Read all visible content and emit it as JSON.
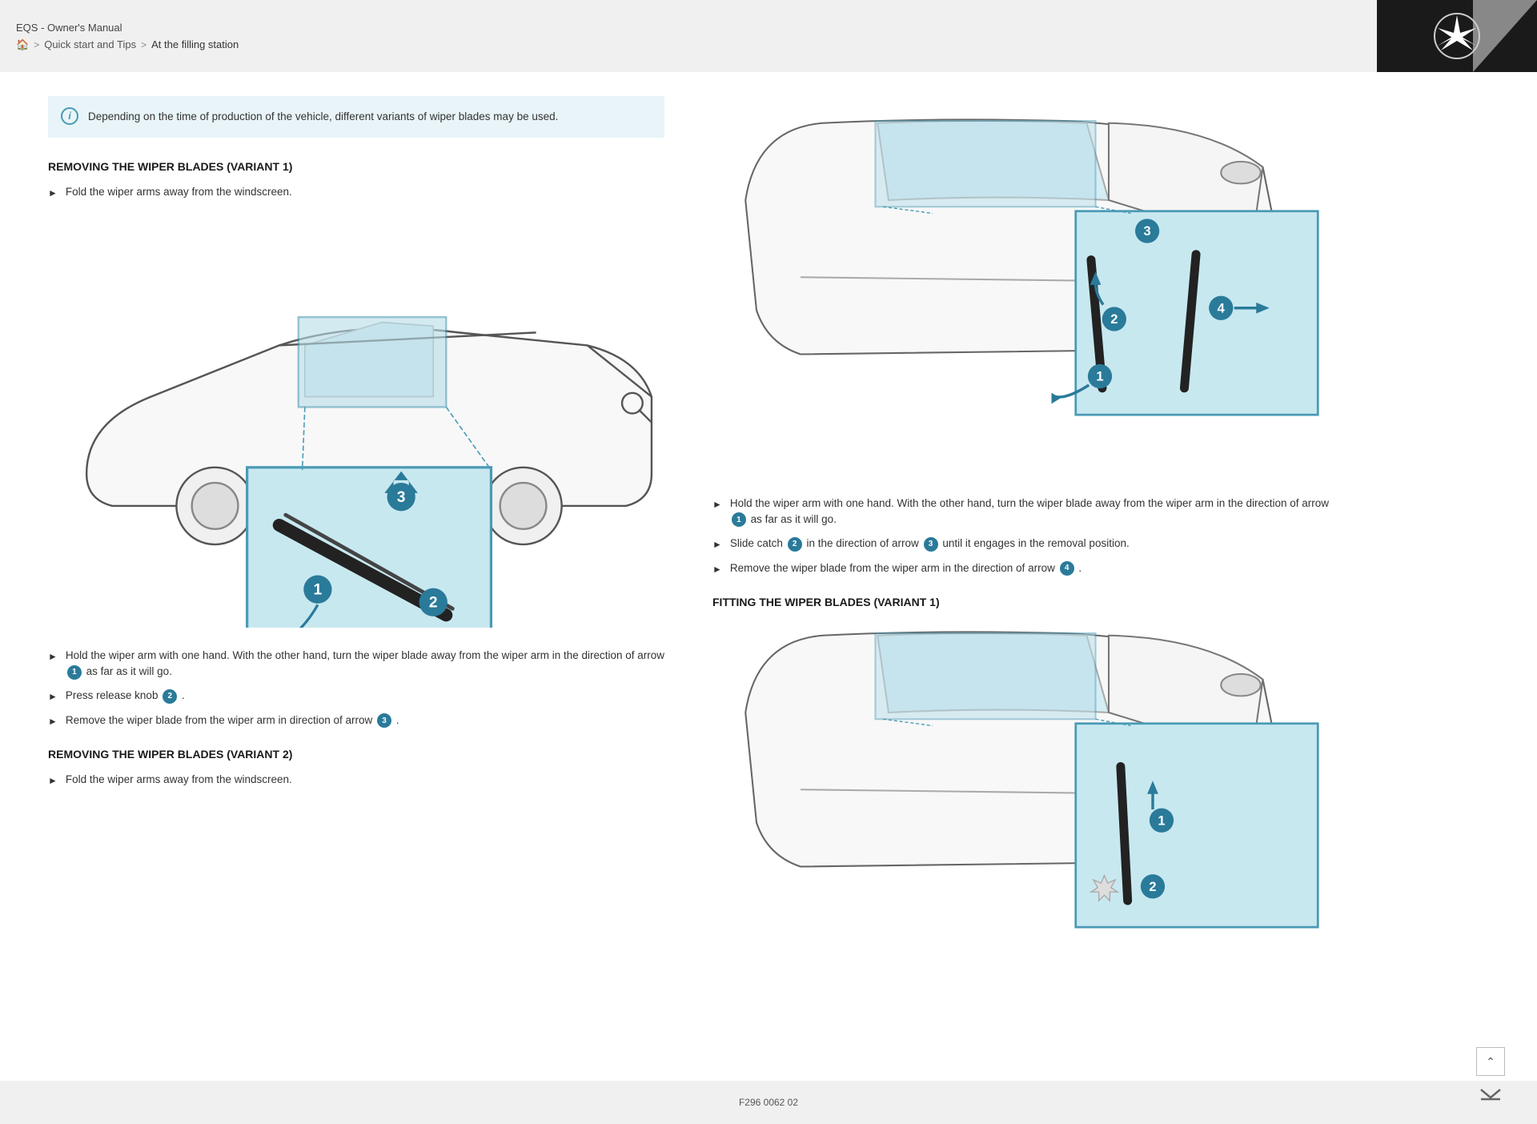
{
  "header": {
    "title": "EQS - Owner's Manual",
    "breadcrumb": {
      "home_label": "🏠",
      "separator": ">",
      "step1": "Quick start and Tips",
      "step2": "At the filling station"
    }
  },
  "info_box": {
    "text": "Depending on the time of production of the vehicle, different variants of wiper blades may be used."
  },
  "left_column": {
    "section1_heading": "REMOVING THE WIPER BLADES (VARIANT 1)",
    "step1": "Fold the wiper arms away from the windscreen.",
    "step2_prefix": "Hold the wiper arm with one hand. With the other hand, turn the wiper blade away from the wiper arm in the direction of arrow",
    "step2_badge": "1",
    "step2_suffix": "as far as it will go.",
    "step3_prefix": "Press release knob",
    "step3_badge": "2",
    "step3_suffix": ".",
    "step4_prefix": "Remove the wiper blade from the wiper arm in direction of arrow",
    "step4_badge": "3",
    "step4_suffix": ".",
    "section2_heading": "REMOVING THE WIPER BLADES (VARIANT 2)",
    "section2_step1": "Fold the wiper arms away from the windscreen."
  },
  "right_column": {
    "step1_prefix": "Hold the wiper arm with one hand. With the other hand, turn the wiper blade away from the wiper arm in the direction of arrow",
    "step1_badge": "1",
    "step1_suffix": "as far as it will go.",
    "step2_prefix": "Slide catch",
    "step2_badge": "2",
    "step2_middle": "in the direction of arrow",
    "step2_badge2": "3",
    "step2_suffix": "until it engages in the removal position.",
    "step3_prefix": "Remove the wiper blade from the wiper arm in the direction of arrow",
    "step3_badge": "4",
    "step3_suffix": ".",
    "section_heading": "FITTING THE WIPER BLADES (VARIANT 1)"
  },
  "footer": {
    "doc_number": "F296 0062 02"
  }
}
